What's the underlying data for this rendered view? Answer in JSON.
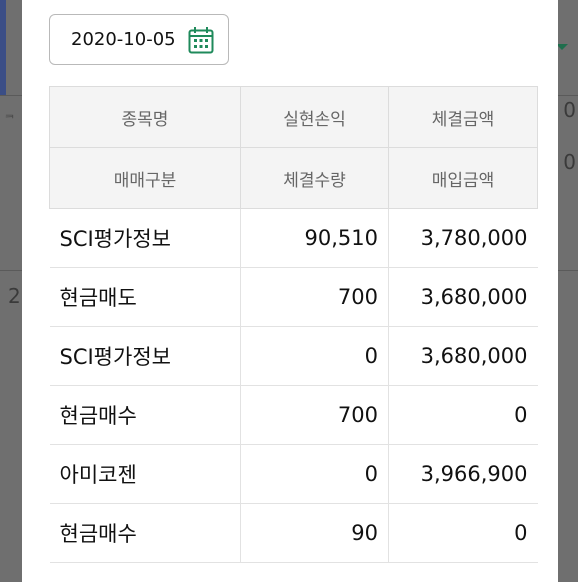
{
  "date_picker": {
    "value": "2020-10-05",
    "icon": "calendar-icon",
    "accent": "#1f8a5b"
  },
  "background_fragments": {
    "left_top": "ᆿ",
    "left_mid": "2",
    "right_a": "0",
    "right_b": "0"
  },
  "table": {
    "headers_row1": [
      "종목명",
      "실현손익",
      "체결금액"
    ],
    "headers_row2": [
      "매매구분",
      "체결수량",
      "매입금액"
    ],
    "rows": [
      {
        "name": "SCI평가정보",
        "value": "90,510",
        "amount": "3,780,000",
        "highlight": "#c8322d"
      },
      {
        "name": "현금매도",
        "value": "700",
        "amount": "3,680,000"
      },
      {
        "name": "SCI평가정보",
        "value": "0",
        "amount": "3,680,000"
      },
      {
        "name": "현금매수",
        "value": "700",
        "amount": "0"
      },
      {
        "name": "아미코젠",
        "value": "0",
        "amount": "3,966,900"
      },
      {
        "name": "현금매수",
        "value": "90",
        "amount": "0"
      }
    ]
  }
}
